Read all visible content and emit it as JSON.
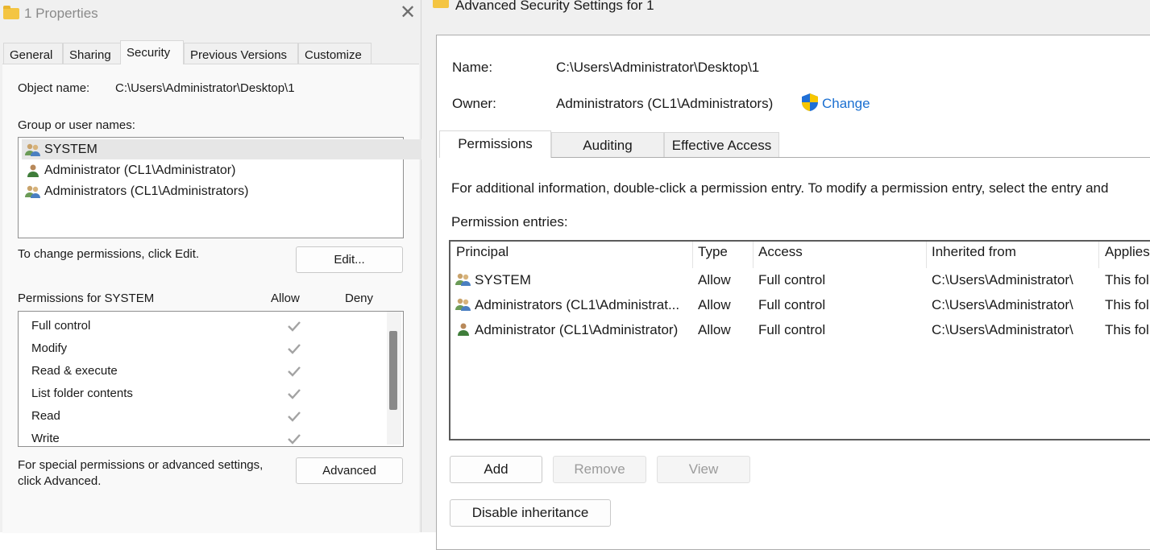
{
  "properties": {
    "title": "1 Properties",
    "close_glyph": "✕",
    "tabs": [
      {
        "label": "General"
      },
      {
        "label": "Sharing"
      },
      {
        "label": "Security",
        "active": true
      },
      {
        "label": "Previous Versions"
      },
      {
        "label": "Customize"
      }
    ],
    "object_name_label": "Object name:",
    "object_name_value": "C:\\Users\\Administrator\\Desktop\\1",
    "group_label": "Group or user names:",
    "users": [
      {
        "name": "SYSTEM",
        "icon": "group-icon",
        "selected": true
      },
      {
        "name": "Administrator (CL1\\Administrator)",
        "icon": "user-icon"
      },
      {
        "name": "Administrators (CL1\\Administrators)",
        "icon": "group-icon"
      }
    ],
    "change_hint": "To change permissions, click Edit.",
    "edit_button": "Edit...",
    "permissions_for": "Permissions for SYSTEM",
    "allow_header": "Allow",
    "deny_header": "Deny",
    "permissions": [
      {
        "name": "Full control",
        "allow": true
      },
      {
        "name": "Modify",
        "allow": true
      },
      {
        "name": "Read & execute",
        "allow": true
      },
      {
        "name": "List folder contents",
        "allow": true
      },
      {
        "name": "Read",
        "allow": true
      },
      {
        "name": "Write",
        "allow": true
      }
    ],
    "special_hint_line1": "For special permissions or advanced settings,",
    "special_hint_line2": "click Advanced.",
    "advanced_button": "Advanced"
  },
  "advanced": {
    "title": "Advanced Security Settings for 1",
    "name_label": "Name:",
    "name_value": "C:\\Users\\Administrator\\Desktop\\1",
    "owner_label": "Owner:",
    "owner_value": "Administrators (CL1\\Administrators)",
    "change_link": "Change",
    "tabs": [
      {
        "label": "Permissions",
        "active": true
      },
      {
        "label": "Auditing"
      },
      {
        "label": "Effective Access"
      }
    ],
    "info_text": "For additional information, double-click a permission entry. To modify a permission entry, select the entry and",
    "entries_label": "Permission entries:",
    "columns": [
      "Principal",
      "Type",
      "Access",
      "Inherited from",
      "Applies"
    ],
    "entries": [
      {
        "principal": "SYSTEM",
        "icon": "group-icon",
        "type": "Allow",
        "access": "Full control",
        "inherited": "C:\\Users\\Administrator\\",
        "applies": "This fol"
      },
      {
        "principal": "Administrators (CL1\\Administrat...",
        "icon": "group-icon",
        "type": "Allow",
        "access": "Full control",
        "inherited": "C:\\Users\\Administrator\\",
        "applies": "This fol"
      },
      {
        "principal": "Administrator (CL1\\Administrator)",
        "icon": "user-icon",
        "type": "Allow",
        "access": "Full control",
        "inherited": "C:\\Users\\Administrator\\",
        "applies": "This fol"
      }
    ],
    "add_button": "Add",
    "remove_button": "Remove",
    "view_button": "View",
    "disable_inheritance_button": "Disable inheritance"
  },
  "colors": {
    "link": "#1a6fd1",
    "shield_blue": "#1f6fd6",
    "shield_yellow": "#f7c600",
    "folder": "#f4c542"
  }
}
